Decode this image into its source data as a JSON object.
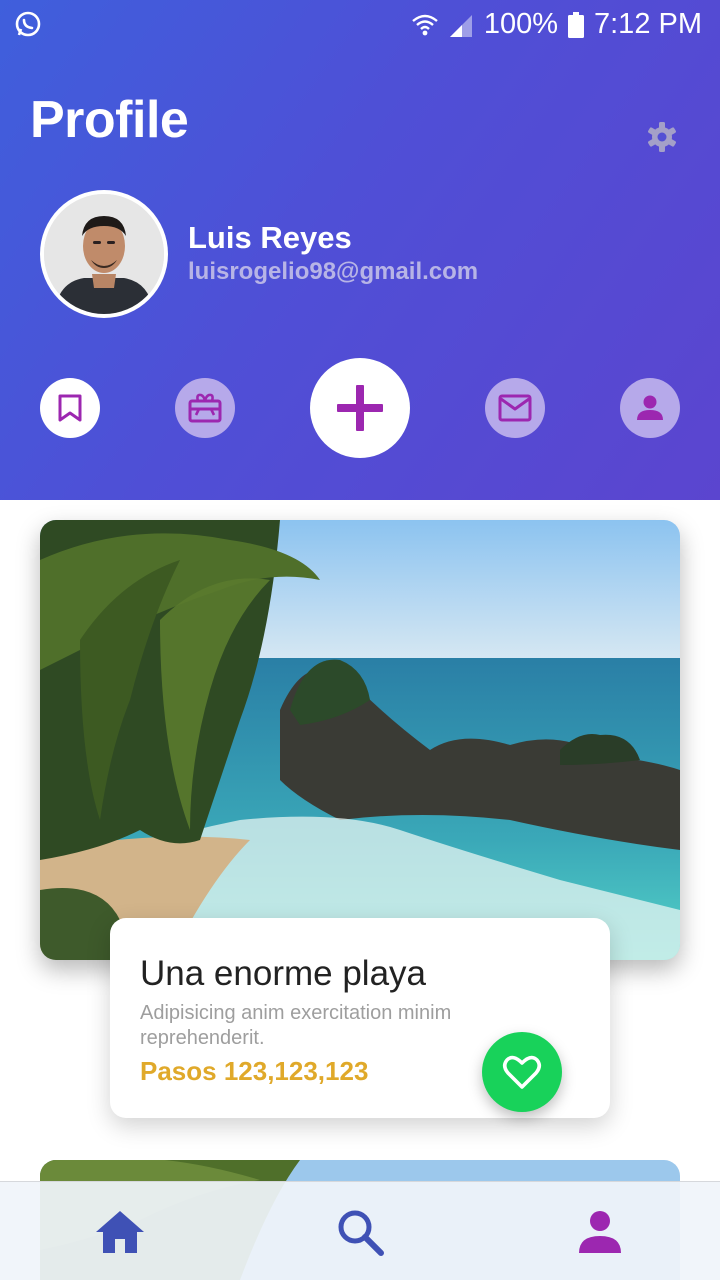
{
  "status_bar": {
    "battery": "100%",
    "time": "7:12 PM",
    "left_icon": "whatsapp-icon",
    "right_icons": [
      "wifi-icon",
      "signal-icon",
      "battery-icon"
    ]
  },
  "header": {
    "title": "Profile",
    "settings_icon": "gear-icon",
    "colors": {
      "gradient_start": "#3f5fdc",
      "gradient_end": "#5b45cf"
    }
  },
  "user": {
    "name": "Luis Reyes",
    "email": "luisrogelio98@gmail.com"
  },
  "actions": [
    {
      "icon": "bookmark-icon",
      "style": "white"
    },
    {
      "icon": "gift-card-icon",
      "style": "light"
    },
    {
      "icon": "plus-icon",
      "style": "big"
    },
    {
      "icon": "mail-icon",
      "style": "light"
    },
    {
      "icon": "account-icon",
      "style": "light"
    }
  ],
  "card": {
    "title": "Una enorme playa",
    "description": "Adipisicing anim exercitation minim reprehenderit.",
    "steps": "Pasos 123,123,123",
    "like_icon": "heart-icon",
    "colors": {
      "steps": "#e0a92a",
      "like": "#18d25a"
    }
  },
  "bottom_nav": [
    {
      "icon": "home-icon",
      "color": "#3f51b5"
    },
    {
      "icon": "search-icon",
      "color": "#3f51b5"
    },
    {
      "icon": "person-icon",
      "color": "#9c27b0"
    }
  ]
}
